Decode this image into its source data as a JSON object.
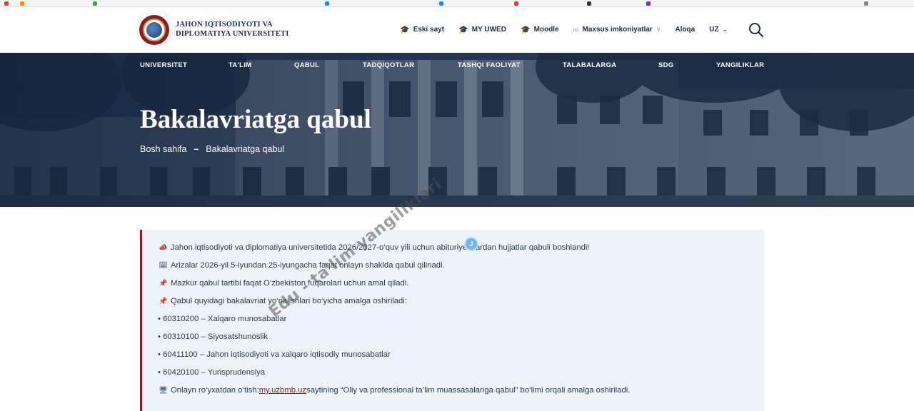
{
  "brand": {
    "name_line1": "JAHON IQTISODIYOTI VA",
    "name_line2": "DIPLOMATIYA UNIVERSITETI"
  },
  "top_links": [
    {
      "label": "Eski sayt",
      "icon": "graduation-cap-icon"
    },
    {
      "label": "MY UWED",
      "icon": "graduation-cap-icon"
    },
    {
      "label": "Moodle",
      "icon": "graduation-cap-icon"
    },
    {
      "label": "Maxsus imkoniyatlar",
      "icon": "glasses-icon"
    },
    {
      "label": "Aloqa"
    },
    {
      "label": "UZ"
    }
  ],
  "main_nav": [
    "UNIVERSITET",
    "TA'LIM",
    "QABUL",
    "TADQIQOTLAR",
    "TASHQI FAOLIYAT",
    "TALABALARGA",
    "SDG",
    "YANGILIKLAR"
  ],
  "hero": {
    "title": "Bakalavriatga qabul",
    "breadcrumb_home": "Bosh sahifa",
    "breadcrumb_sep": "–",
    "breadcrumb_current": "Bakalavriatga qabul"
  },
  "notice": {
    "line1": "Jahon iqtisodiyoti va diplomatiya universitetida 2026/2027-o‘quv yili uchun abituriyentlardan hujjatlar qabuli boshlandi!",
    "line2": "Arizalar 2026-yil 5-iyundan 25-iyungacha faqat onlayn shaklda qabul qilinadi.",
    "line3": "Mazkur qabul tartibi faqat O‘zbekiston fuqarolari uchun amal qiladi.",
    "line4": "Qabul quyidagi bakalavriat yo‘nalishlari bo‘yicha amalga oshiriladi:",
    "programs": [
      "• 60310200 – Xalqaro munosabatlar",
      "• 60310100 – Siyosatshunoslik",
      "• 60411100 – Jahon iqtisodiyoti va xalqaro iqtisodiy munosabatlar",
      "• 60420100 – Yurisprudensiya"
    ],
    "online_prefix": "Onlayn ro‘yxatdan o‘tish: ",
    "online_link": "my.uzbmb.uz",
    "online_suffix": " saytining “Oliy va professional ta’lim muassasalariga qabul” bo‘limi orqali amalga oshiriladi."
  },
  "watermark": {
    "text": "Edu - ta'lim yangiliklari",
    "badge": "J"
  },
  "colors": {
    "brand_red": "#8e1b22",
    "nav_dark": "#1e3350",
    "notice_bg": "#eef3f9"
  }
}
